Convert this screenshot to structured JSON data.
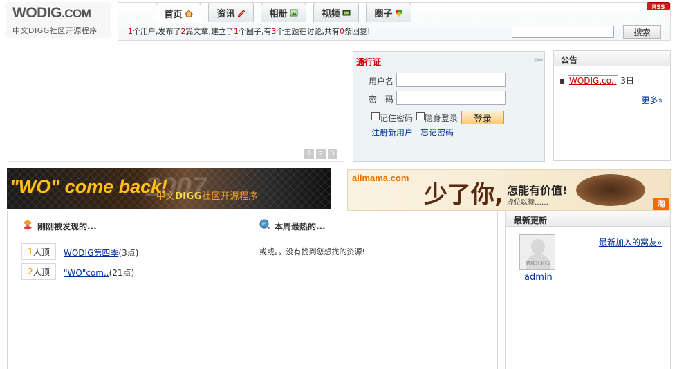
{
  "header": {
    "logo_main": "WODIG",
    "logo_com": ".COM",
    "tagline": "中文DIGG社区开源程序",
    "tabs": [
      {
        "label": "首页",
        "icon": "home-icon"
      },
      {
        "label": "资讯",
        "icon": "pencil-icon"
      },
      {
        "label": "相册",
        "icon": "photo-icon"
      },
      {
        "label": "视频",
        "icon": "film-icon"
      },
      {
        "label": "圈子",
        "icon": "circle-group-icon"
      }
    ],
    "rss_label": "RSS",
    "stats": {
      "n_users": "1",
      "t1": "个用户,发布了",
      "n_articles": "2",
      "t2": "篇文章,建立了",
      "n_circles": "1",
      "t3": "个圈子,有",
      "n_topics": "3",
      "t4": "个主题在讨论,共有",
      "n_replies": "0",
      "t5": "条回复!"
    },
    "search": {
      "placeholder": "",
      "button": "搜索"
    }
  },
  "slideshow": {
    "pages": [
      "1",
      "2",
      "3"
    ]
  },
  "login": {
    "title": "通行证",
    "username_label": "用户名",
    "password_label": "密　码",
    "remember_label": "记住密码",
    "invisible_label": "隐身登录",
    "login_button": "登录",
    "register_link": "注册新用户",
    "forgot_link": "忘记密码"
  },
  "notice": {
    "title": "公告",
    "items": [
      {
        "title": "WODIG.co..",
        "date": "3日"
      }
    ],
    "more": "更多»"
  },
  "banner_left": {
    "headline": "\"WO\" come back!",
    "year": "2007",
    "sub_prefix": "中文",
    "sub_bold": "DIGG",
    "sub_suffix": "社区开源程序"
  },
  "banner_right": {
    "logo": "alimama.com",
    "big_text": "少了你,",
    "question": "怎能有价值!",
    "small_text": "虚位以待……",
    "corner": "淘"
  },
  "discovered": {
    "title": "刚刚被发现的...",
    "items": [
      {
        "count": "1",
        "unit": "人顶",
        "title": "WODIG第四季",
        "points": "(3点)"
      },
      {
        "count": "2",
        "unit": "人顶",
        "title": "\"WO\"com..",
        "points": "(21点)"
      }
    ]
  },
  "hot": {
    "title": "本周最热的...",
    "empty": "或或。。没有找到您想找的资源!"
  },
  "latest": {
    "title": "最新更新",
    "new_friends": "最新加入的窝友»",
    "avatar_watermark": "WODIG",
    "user": "admin"
  },
  "colors": {
    "accent_red": "#cc0000",
    "link_blue": "#003399",
    "digg_orange": "#f08a00"
  }
}
